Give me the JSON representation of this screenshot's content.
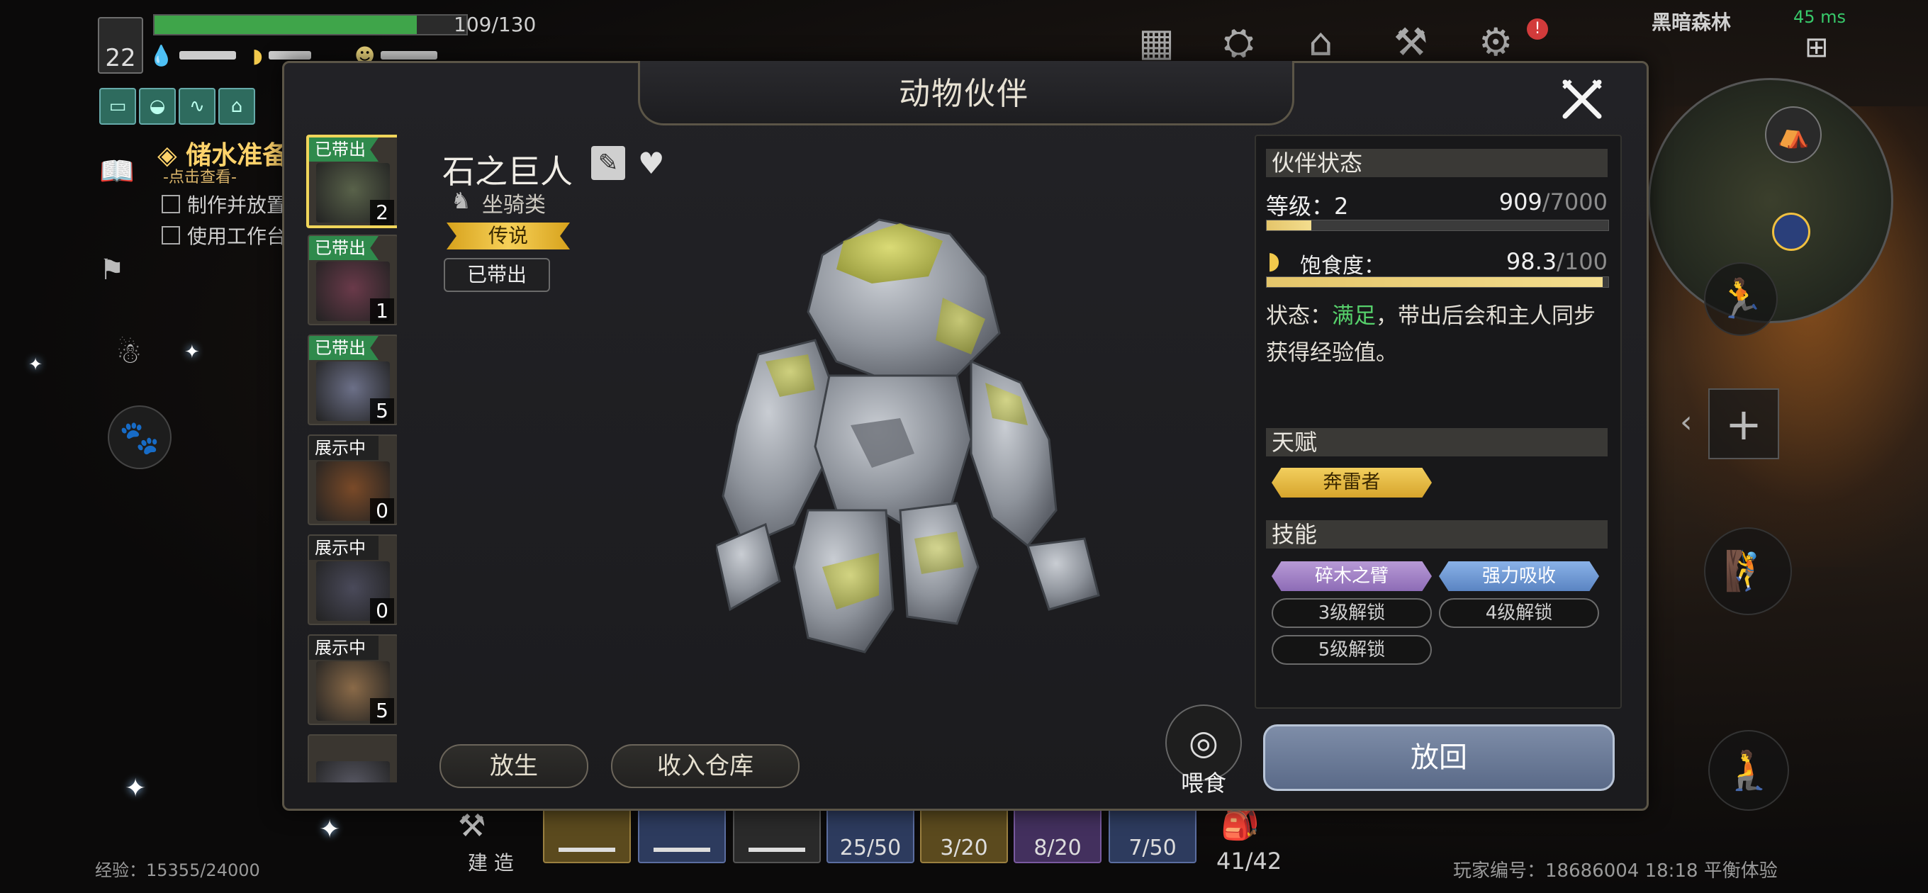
{
  "hud": {
    "player_level": "22",
    "hp_text": "109/130",
    "hp_fraction": 0.84,
    "quest_title": "储水准备",
    "quest_hint": "-点击查看-",
    "quest_items": [
      "制作并放置",
      "使用工作台"
    ],
    "region": "黑暗森林",
    "ping": "45 ms",
    "build_label": "建 造",
    "slot_counts": [
      "25/50",
      "3/20",
      "8/20",
      "7/50"
    ],
    "bag_count": "41/42",
    "exp_text": "经验：15355/24000",
    "player_id_text": "玩家编号：18686004  18:18  平衡体验"
  },
  "dialog": {
    "title": "动物伙伴",
    "close_icon": "crossed-swords-close-icon"
  },
  "pets": [
    {
      "tag": "已带出",
      "tag_kind": "out",
      "count": "2",
      "color": "#59624a"
    },
    {
      "tag": "已带出",
      "tag_kind": "out",
      "count": "1",
      "color": "#6a3a4a"
    },
    {
      "tag": "已带出",
      "tag_kind": "out",
      "count": "5",
      "color": "#6c7088"
    },
    {
      "tag": "展示中",
      "tag_kind": "show",
      "count": "0",
      "color": "#7a4a28"
    },
    {
      "tag": "展示中",
      "tag_kind": "show",
      "count": "0",
      "color": "#4a4a5a"
    },
    {
      "tag": "展示中",
      "tag_kind": "show",
      "count": "5",
      "color": "#8a6a48"
    },
    {
      "tag": "",
      "tag_kind": "none",
      "count": "",
      "color": "#5a5a66"
    }
  ],
  "selected_pet": {
    "name": "石之巨人",
    "type": "坐骑类",
    "rarity": "传说",
    "out_badge": "已带出"
  },
  "buttons": {
    "release": "放生",
    "store": "收入仓库",
    "feed": "喂食",
    "return": "放回"
  },
  "status": {
    "section_title": "伙伴状态",
    "level_label": "等级：2",
    "exp_current": "909",
    "exp_max": "/7000",
    "exp_fraction": 0.13,
    "hunger_label": "饱食度：",
    "hunger_current": "98.3",
    "hunger_max": "/100",
    "hunger_fraction": 0.983,
    "status_prefix": "状态：",
    "status_value": "满足",
    "status_suffix": "，带出后会和主人同步获得经验值。"
  },
  "talent": {
    "section_title": "天赋",
    "name": "奔雷者"
  },
  "skills": {
    "section_title": "技能",
    "items": [
      "碎木之臂",
      "强力吸收",
      "3级解锁",
      "4级解锁",
      "5级解锁"
    ]
  },
  "colors": {
    "accent_gold": "#f0d55a",
    "status_good": "#56d06b",
    "tag_green": "#2f8a4c"
  }
}
